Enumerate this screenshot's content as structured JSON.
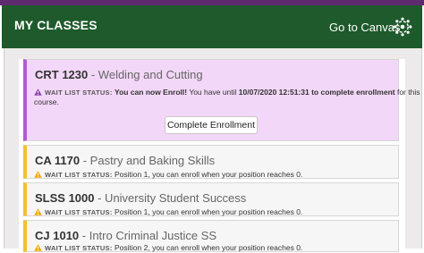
{
  "header": {
    "title": "MY CLASSES",
    "link_label": "Go to Canvas",
    "logo_icon": "canvas-logo-icon"
  },
  "colors": {
    "header_green": "#1e5a2b",
    "top_strip_purple": "#5e2b6e",
    "warning_yellow": "#f2c12e",
    "action_purple_border": "#b35ad6",
    "action_purple_bg": "#f3d7f8"
  },
  "status_label": "WAIT LIST STATUS:",
  "courses": [
    {
      "code": "CRT 1230",
      "name": " - Welding and Cutting",
      "status_bold": "You can now Enroll!",
      "status_text_1": " You have until ",
      "deadline": "10/07/2020 12:51:31",
      "status_text_2": " to complete enrollment",
      "status_text_3": " for this",
      "status_line2": "course.",
      "button_label": "Complete Enrollment",
      "icon": "warning-icon"
    },
    {
      "code": "CA 1170",
      "name": " - Pastry and Baking Skills",
      "status_text": " Position 1, you can enroll when your position reaches 0.",
      "icon": "warning-icon"
    },
    {
      "code": "SLSS 1000",
      "name": " - University Student Success",
      "status_text": " Position 1, you can enroll when your position reaches 0.",
      "icon": "warning-icon"
    },
    {
      "code": "CJ 1010",
      "name": " - Intro Criminal Justice SS",
      "status_text": " Position 2, you can enroll when your position reaches 0.",
      "icon": "warning-icon"
    }
  ]
}
